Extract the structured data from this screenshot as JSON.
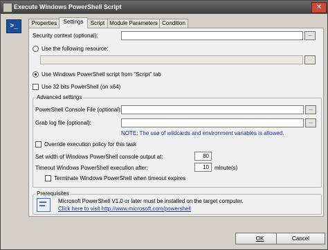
{
  "window": {
    "title": "Execute Windows PowerShell Script",
    "close_glyph": "✕"
  },
  "tabs": [
    {
      "label": "Properties"
    },
    {
      "label": "Settings"
    },
    {
      "label": "Script"
    },
    {
      "label": "Module Parameters"
    },
    {
      "label": "Condition"
    }
  ],
  "settings": {
    "security_context_label": "Security context (optional):",
    "use_resource_label": "Use the following resource:",
    "use_script_tab_label": "Use Windows PowerShell script from \"Script\" tab",
    "use_32bit_label": "Use 32 bits PowerShell (on x64)",
    "browse_label": "..."
  },
  "advanced": {
    "title": "Advanced settings",
    "console_file_label": "PowerShell Console File (optional):",
    "grab_log_label": "Grab log file (optional):",
    "note": "NOTE: The use of wildcards and environment variables is allowed.",
    "override_policy_label": "Override execution policy for this task",
    "width_label": "Set width of Windows PowerShell console output at:",
    "width_value": "80",
    "timeout_label": "Timeout Windows PowerShell execution after:",
    "timeout_value": "10",
    "timeout_unit": "minute(s)",
    "terminate_label": "Terminate Windows PowerShell when timeout expires"
  },
  "prerequisites": {
    "title": "Prerequisites",
    "text": "Microsoft PowerShell V1.0 or later must be installed on the target computer.",
    "link": "Click here to visit http://www.microsoft.com/powershell"
  },
  "buttons": {
    "ok": "OK",
    "cancel": "Cancel"
  },
  "colors": {
    "note": "#1b2c95",
    "titlebar": "#4a4a4a"
  }
}
